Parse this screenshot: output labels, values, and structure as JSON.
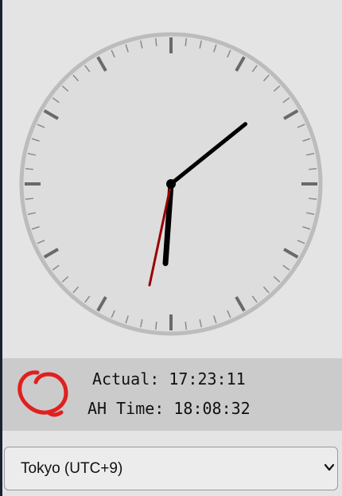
{
  "clock": {
    "ah_time": {
      "hours": 18,
      "minutes": 8,
      "seconds": 32
    },
    "face_color": "#dddddd",
    "rim_color": "#bcbcbc",
    "tick_color": "#6a6a6a",
    "hand_color": "#000000",
    "second_hand_color": "#990000"
  },
  "info": {
    "actual_label": "Actual:",
    "actual_time": "17:23:11",
    "ah_label": "AH Time:",
    "ah_time": "18:08:32",
    "logo_icon": "ah-logo-icon",
    "logo_color": "#e02020"
  },
  "timezone": {
    "selected": "Tokyo (UTC+9)"
  }
}
